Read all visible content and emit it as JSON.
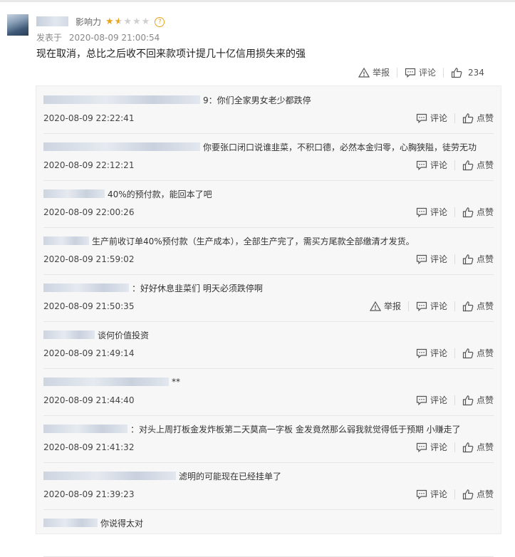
{
  "post": {
    "influence_label": "影响力",
    "stars": [
      "full",
      "half",
      "empty",
      "empty",
      "empty"
    ],
    "posted_prefix": "发表于",
    "posted_time": "2020-08-09 21:00:54",
    "content": "现在取消，总比之后收不回来款项计提几十亿信用损失来的强",
    "actions": {
      "report": "举报",
      "comment": "评论",
      "like_count": "234"
    }
  },
  "replies": [
    {
      "blur_width": 220,
      "text": "9：你们全家男女老少都跌停",
      "time": "2020-08-09 22:22:41",
      "show_report": false
    },
    {
      "blur_width": 220,
      "text": "你要张口闭口说谁韭菜，不积口德，必然本金归零，心胸狭隘，徒劳无功",
      "time": "2020-08-09 22:12:21",
      "show_report": false
    },
    {
      "blur_width": 86,
      "text": "40%的预付款，能回本了吧",
      "time": "2020-08-09 22:00:26",
      "show_report": false
    },
    {
      "blur_width": 64,
      "text": "生产前收订单40%预付款（生产成本），全部生产完了，需买方尾款全部缴清才发货。",
      "time": "2020-08-09 21:59:02",
      "show_report": false
    },
    {
      "blur_width": 120,
      "text": "：好好休息韭菜们 明天必须跌停啊",
      "time": "2020-08-09 21:50:35",
      "show_report": true
    },
    {
      "blur_width": 72,
      "text": "谈何价值投资",
      "time": "2020-08-09 21:49:14",
      "show_report": false
    },
    {
      "blur_width": 176,
      "text": "**",
      "time": "2020-08-09 21:44:40",
      "show_report": false
    },
    {
      "blur_width": 118,
      "text": "：对头上周打板金发炸板第二天莫高一字板 金发竟然那么弱我就觉得低于预期 小赚走了",
      "time": "2020-08-09 21:41:32",
      "show_report": false
    },
    {
      "blur_width": 186,
      "text": "滤明的可能现在已经挂单了",
      "time": "2020-08-09 21:39:23",
      "show_report": false
    },
    {
      "blur_width": 76,
      "text": "你说得太对",
      "time": "",
      "show_report": false
    }
  ],
  "labels": {
    "comment": "评论",
    "like": "点赞",
    "report": "举报"
  },
  "colors": {
    "star": "#e8a41c",
    "reply_bg": "#f7f7f7"
  }
}
